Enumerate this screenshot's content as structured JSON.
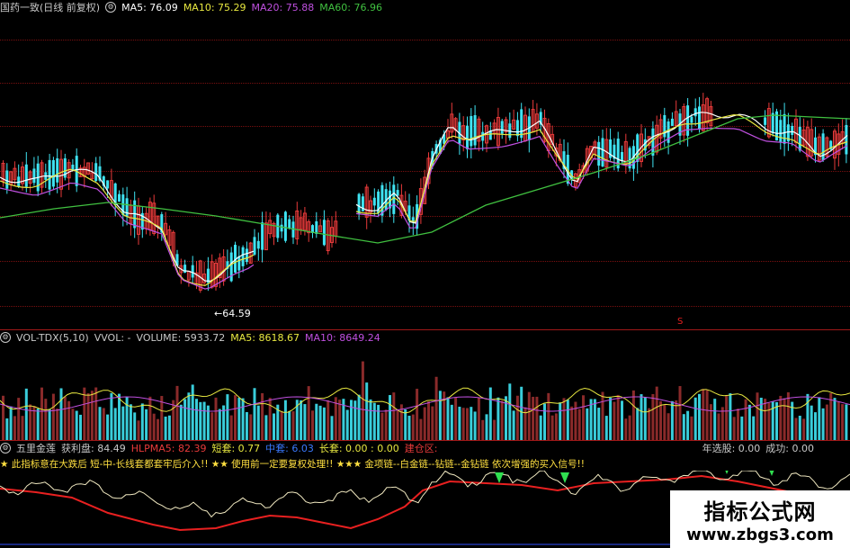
{
  "colors": {
    "up": "#e83a3a",
    "down": "#3fe3f2",
    "ma5": "#ffffff",
    "ma10": "#e8e840",
    "ma20": "#c050e0",
    "ma60": "#40c040",
    "red_line": "#e82020"
  },
  "price_panel": {
    "title": "国药一致(日线 前复权)",
    "ma5": "MA5: 76.09",
    "ma10": "MA10: 75.29",
    "ma20": "MA20: 75.88",
    "ma60": "MA60: 76.96",
    "low_marker": "←64.59",
    "s_marker": "S"
  },
  "volume_panel": {
    "title": "VOL-TDX(5,10)",
    "vvol": "VVOL: -",
    "volume": "VOLUME: 5933.72",
    "ma5": "MA5: 8618.67",
    "ma10": "MA10: 8649.24"
  },
  "indicator_panel": {
    "title": "五里金莲",
    "profit": "获利盘: 84.49",
    "hlpma5": "HLPMA5: 82.39",
    "short": "短套: 0.77",
    "mid": "中套: 6.03",
    "long": "长套: 0.00 : 0.00",
    "build": "建仓区: ",
    "year_select": "年选股: 0.00",
    "success": "成功: 0.00",
    "ticker": "★ 此指标意在大跌后 短-中-长线套都套牢后介入!! ★★ 使用前一定要复权处理!! ★★★ 金项链--白金链--钻链--金钻链 依次增强的买入信号!!"
  },
  "watermark": {
    "line1": "指标公式网",
    "line2": "www.zbgs3.com"
  }
}
